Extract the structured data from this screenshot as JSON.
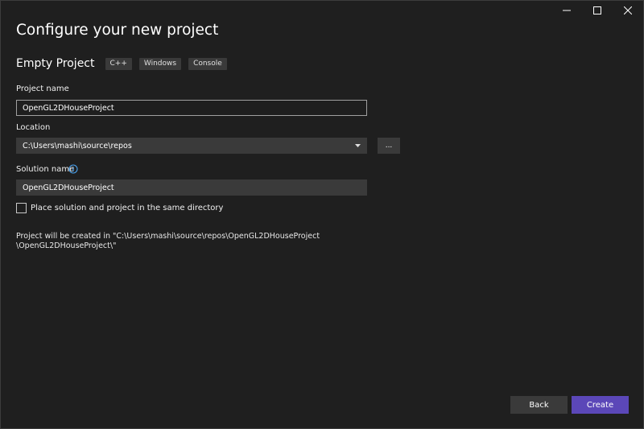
{
  "window": {
    "controls": {
      "minimize": "minimize-icon",
      "maximize": "maximize-icon",
      "close": "close-icon"
    }
  },
  "header": {
    "title": "Configure your new project"
  },
  "template": {
    "name": "Empty Project",
    "tags": [
      "C++",
      "Windows",
      "Console"
    ]
  },
  "form": {
    "project_name": {
      "label": "Project name",
      "value": "OpenGL2DHouseProject"
    },
    "location": {
      "label": "Location",
      "value": "C:\\Users\\mashi\\source\\repos",
      "browse_label": "..."
    },
    "solution_name": {
      "label": "Solution name",
      "value": "OpenGL2DHouseProject"
    },
    "same_directory": {
      "label": "Place solution and project in the same directory",
      "checked": false
    },
    "path_info": {
      "line1": "Project will be created in \"C:\\Users\\mashi\\source\\repos\\OpenGL2DHouseProject",
      "line2": "\\OpenGL2DHouseProject\\\""
    }
  },
  "footer": {
    "back_label": "Back",
    "create_label": "Create"
  },
  "colors": {
    "background": "#1f1f1f",
    "field_bg": "#3a3a3a",
    "accent": "#5b47b8",
    "info_icon": "#4aa3f0"
  }
}
